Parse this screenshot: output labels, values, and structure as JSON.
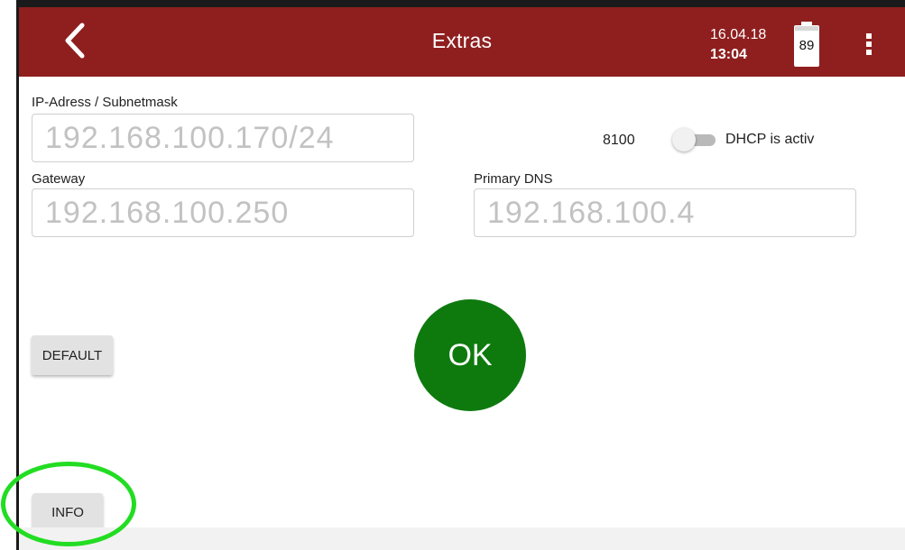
{
  "appbar": {
    "title": "Extras",
    "date": "16.04.18",
    "time": "13:04",
    "battery_level": "89",
    "background_color": "#8f1f1f"
  },
  "network": {
    "ip_label": "IP-Adress / Subnetmask",
    "ip_placeholder": "192.168.100.170/24",
    "gateway_label": "Gateway",
    "gateway_placeholder": "192.168.100.250",
    "dns_label": "Primary DNS",
    "dns_placeholder": "192.168.100.4",
    "port": "8100",
    "dhcp_label": "DHCP is activ",
    "dhcp_on": false
  },
  "buttons": {
    "default_label": "DEFAULT",
    "ok_label": "OK",
    "info_label": "INFO",
    "ok_color": "#0e7a0e"
  },
  "annotation": {
    "highlight_color": "#22dd22"
  }
}
